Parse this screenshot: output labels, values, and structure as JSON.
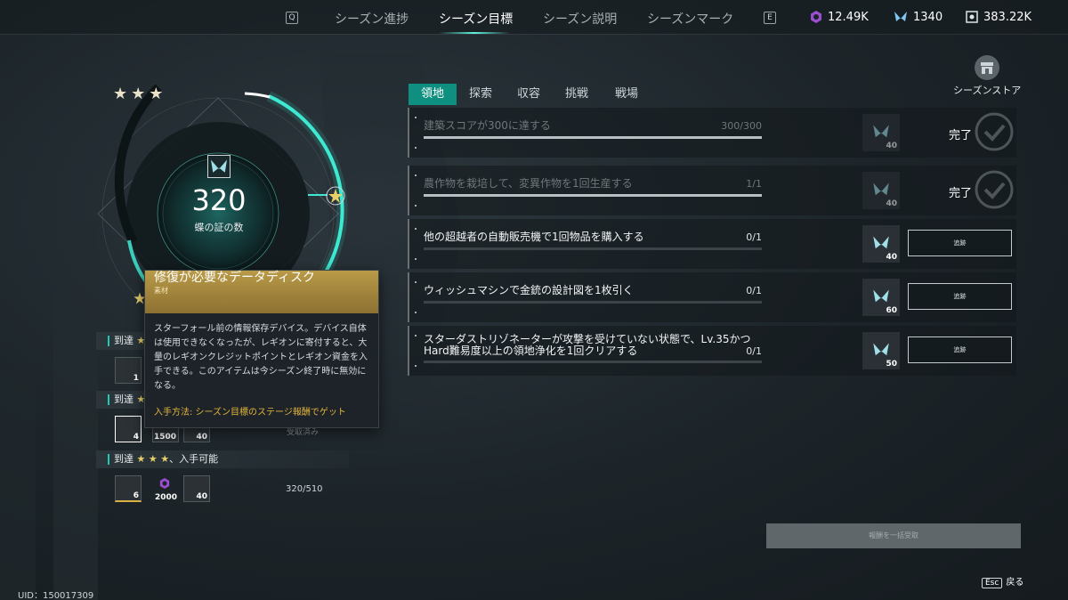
{
  "topnav": {
    "key_left": "Q",
    "key_right": "E",
    "tabs": [
      "シーズン進捗",
      "シーズン目標",
      "シーズン説明",
      "シーズンマーク"
    ],
    "active_tab": "シーズン目標",
    "currencies": [
      {
        "icon": "purple-gear-icon",
        "value": "12.49K"
      },
      {
        "icon": "butterfly-badge-icon",
        "value": "1340"
      },
      {
        "icon": "square-shield-icon",
        "value": "383.22K"
      }
    ]
  },
  "categories": [
    "領地",
    "探索",
    "収容",
    "挑戦",
    "戦場"
  ],
  "active_category": "領地",
  "store_label": "シーズンストア",
  "tasks": [
    {
      "title": "建築スコアが300に達する",
      "progress": "300/300",
      "fill": 1.0,
      "reward": "40",
      "status": "完了",
      "done": true
    },
    {
      "title": "農作物を栽培して、変異作物を1回生産する",
      "progress": "1/1",
      "fill": 1.0,
      "reward": "40",
      "status": "完了",
      "done": true
    },
    {
      "title": "他の超越者の自動販売機で1回物品を購入する",
      "progress": "0/1",
      "fill": 0,
      "reward": "40",
      "status": "追跡",
      "done": false
    },
    {
      "title": "ウィッシュマシンで金銃の設計図を1枚引く",
      "progress": "0/1",
      "fill": 0,
      "reward": "60",
      "status": "追跡",
      "done": false
    },
    {
      "title": "スターダストリゾネーターが攻撃を受けていない状態で、Lv.35かつHard難易度以上の領地浄化を1回クリアする",
      "progress": "0/1",
      "fill": 0,
      "reward": "50",
      "status": "追跡",
      "done": false
    }
  ],
  "progress_ring": {
    "value": "320",
    "label": "蝶の証の数",
    "stars": "★★★"
  },
  "levels": [
    {
      "label": "到達",
      "stars": "★",
      "items": [
        {
          "count": "1"
        }
      ]
    },
    {
      "label": "到達",
      "stars": "★",
      "status": "受取済み",
      "items": [
        {
          "count": "4"
        },
        {
          "count": "1500"
        },
        {
          "count": "40"
        }
      ]
    },
    {
      "label": "到達",
      "stars": "★ ★ ★",
      "status": "、入手可能",
      "items": [
        {
          "count": "6"
        },
        {
          "count": "2000"
        },
        {
          "count": "40"
        }
      ],
      "ratio": "320/510"
    }
  ],
  "tooltip": {
    "name": "修復が必要なデータディスク",
    "type": "素材",
    "description": "スターフォール前の情報保存デバイス。デバイス自体は使用できなくなったが、レギオンに寄付すると、大量のレギオンクレジットポイントとレギオン資金を入手できる。このアイテムは今シーズン終了時に無効になる。",
    "how_to_get": "入手方法: シーズン目標のステージ報酬でゲット"
  },
  "bulk_claim": "報酬を一括受取",
  "esc": {
    "key": "Esc",
    "label": "戻る"
  },
  "uid": "UID：150017309",
  "colors": {
    "accent": "#5ff4de",
    "gold": "#b99a47",
    "active_tab": "#0f8f80"
  }
}
